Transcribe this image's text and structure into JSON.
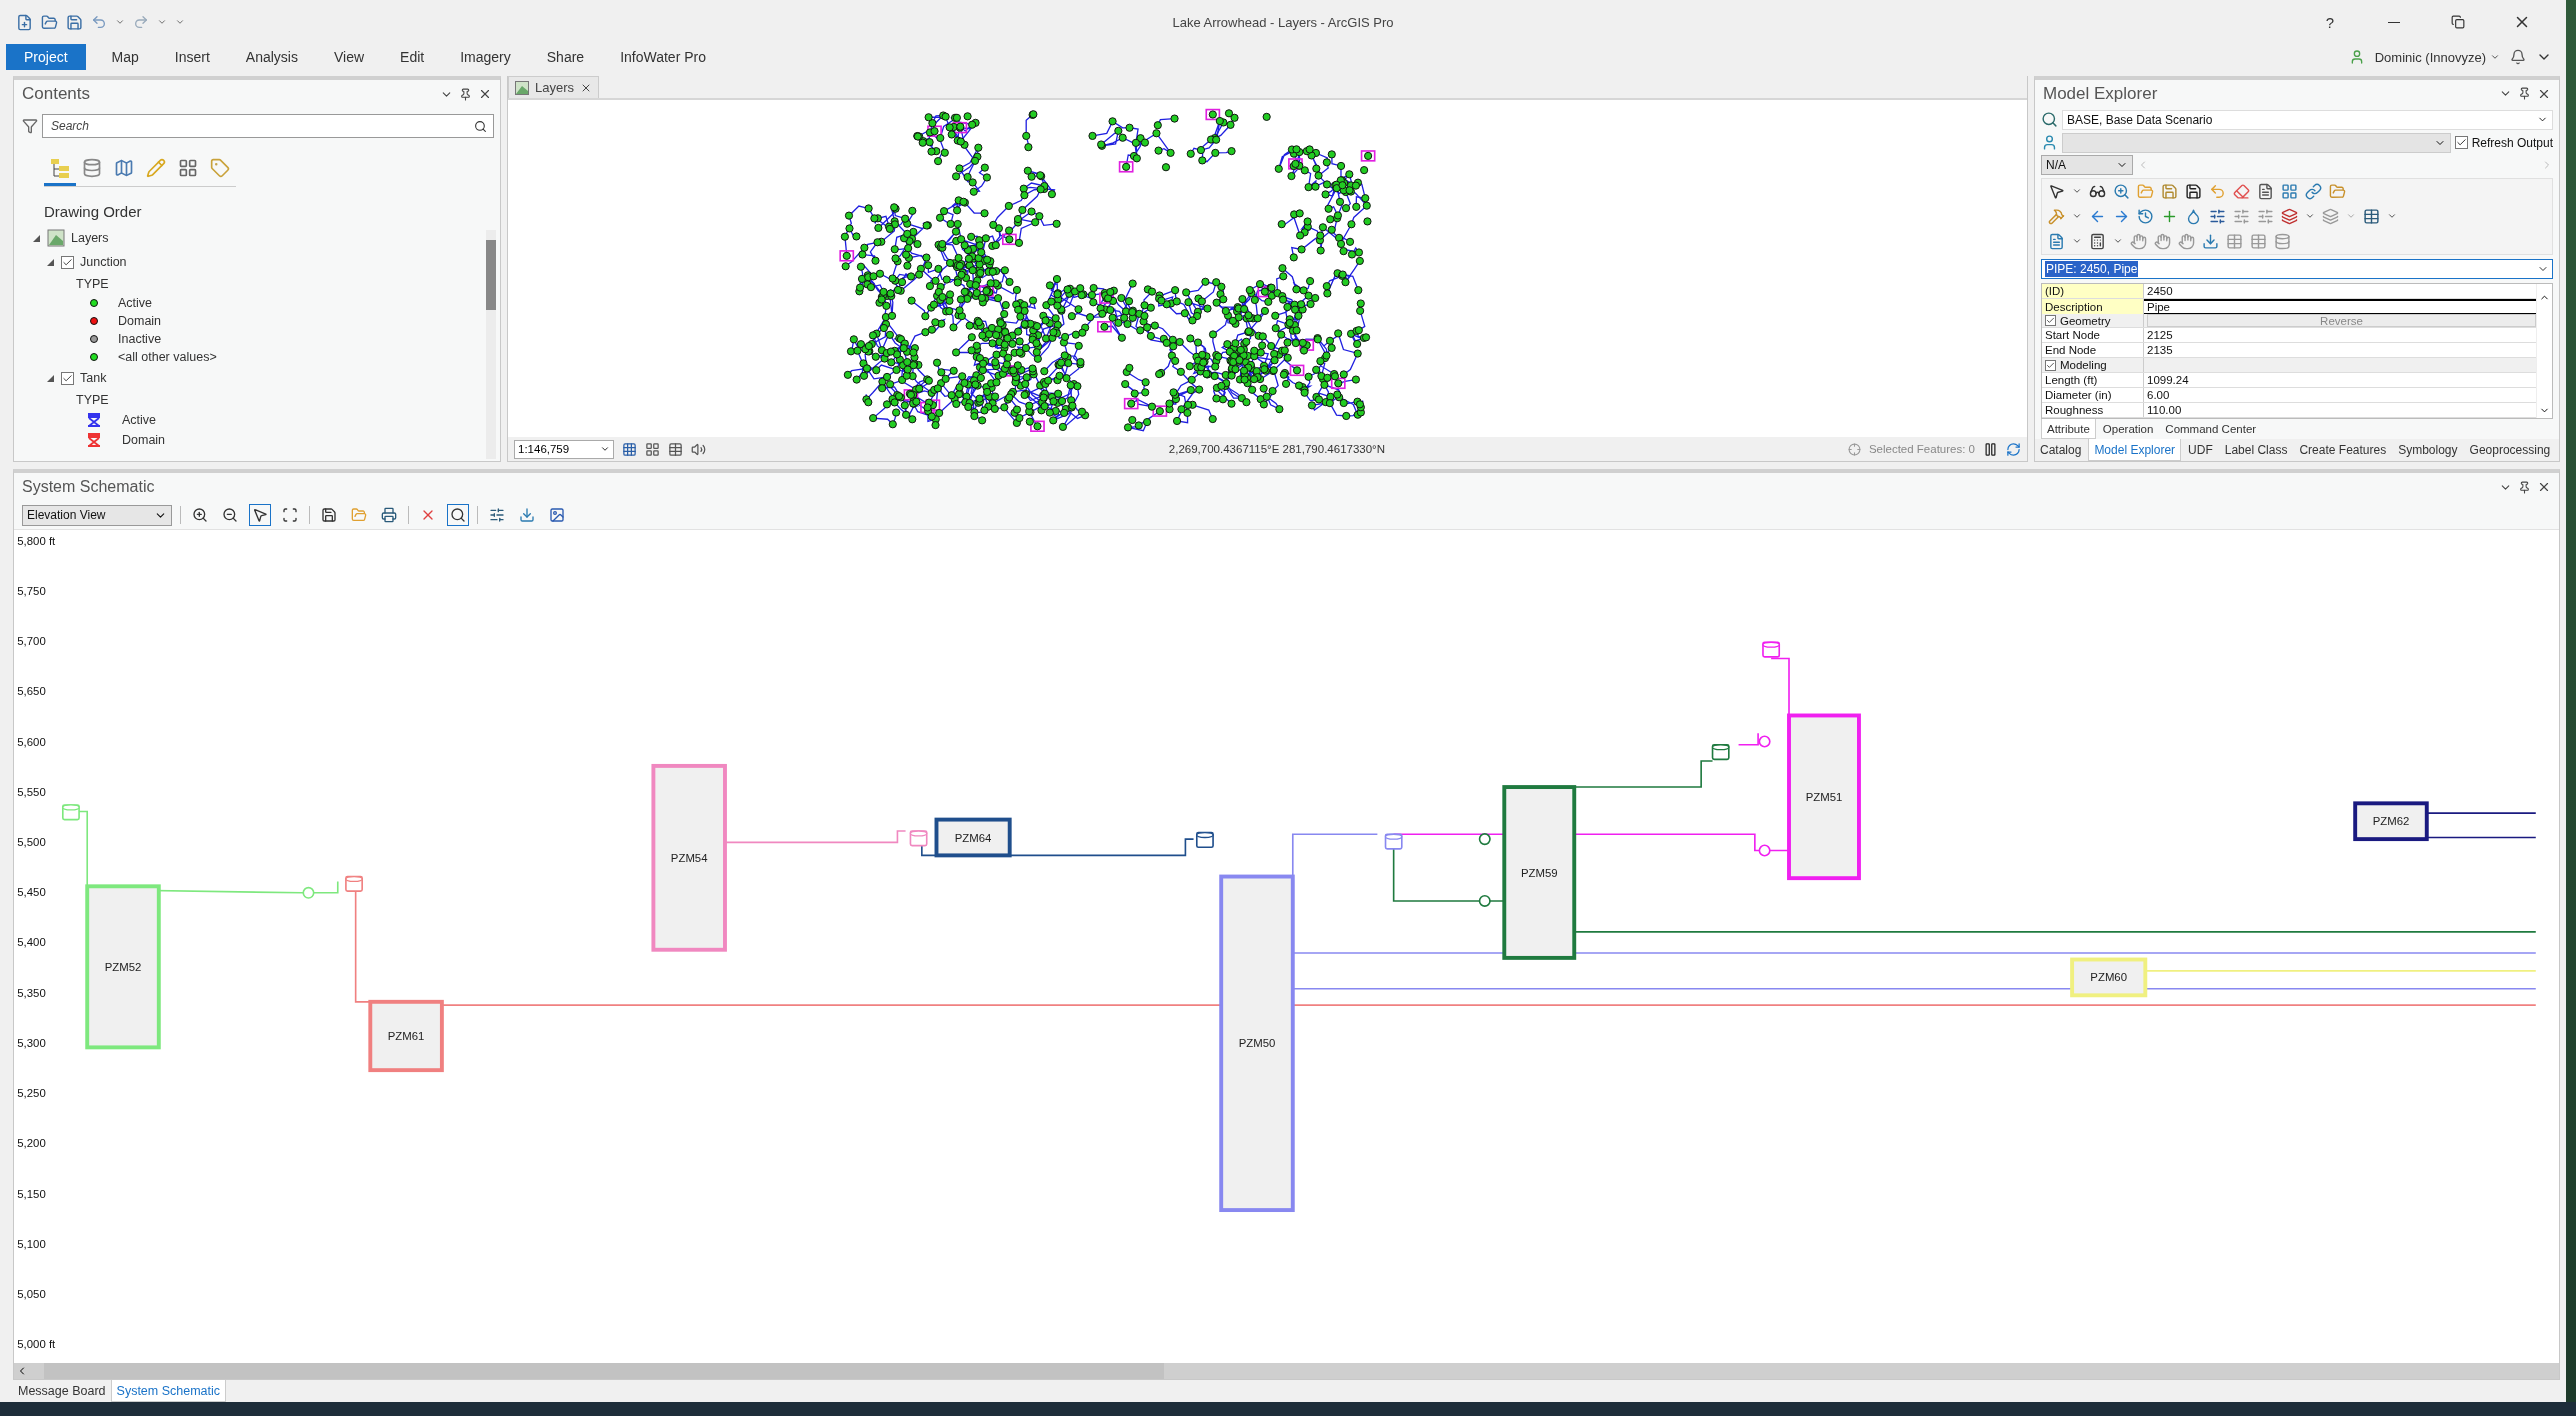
{
  "window": {
    "title": "Lake Arrowhead - Layers - ArcGIS Pro",
    "help": "?"
  },
  "ribbon": {
    "tabs": [
      {
        "label": "Project",
        "selected": true
      },
      {
        "label": "Map",
        "selected": false
      },
      {
        "label": "Insert",
        "selected": false
      },
      {
        "label": "Analysis",
        "selected": false
      },
      {
        "label": "View",
        "selected": false
      },
      {
        "label": "Edit",
        "selected": false
      },
      {
        "label": "Imagery",
        "selected": false
      },
      {
        "label": "Share",
        "selected": false
      },
      {
        "label": "InfoWater Pro",
        "selected": false
      }
    ],
    "user": "Dominic (Innovyze)"
  },
  "contents": {
    "title": "Contents",
    "search": {
      "placeholder": "Search"
    },
    "view_tabs": [
      {
        "selected": true
      },
      {
        "selected": false
      },
      {
        "selected": false
      },
      {
        "selected": false
      },
      {
        "selected": false
      },
      {
        "selected": false
      }
    ],
    "heading": "Drawing Order",
    "tree": [
      {
        "kind": "group",
        "label": "Layers",
        "expanded": true,
        "children": [
          {
            "kind": "layer",
            "label": "Junction",
            "checked": true,
            "expanded": true,
            "children": [
              {
                "kind": "heading",
                "label": "TYPE"
              },
              {
                "kind": "dot",
                "label": "Active",
                "color": "#22dd22"
              },
              {
                "kind": "dot",
                "label": "Domain",
                "color": "#ee1111"
              },
              {
                "kind": "dot",
                "label": "Inactive",
                "color": "#9a9a9a"
              },
              {
                "kind": "dot",
                "label": "<all other values>",
                "color": "#22dd22"
              }
            ]
          },
          {
            "kind": "layer",
            "label": "Tank",
            "checked": true,
            "expanded": true,
            "children": [
              {
                "kind": "heading",
                "label": "TYPE"
              },
              {
                "kind": "tank",
                "label": "Active",
                "color": "#3333ee"
              },
              {
                "kind": "tank",
                "label": "Domain",
                "color": "#ee3333"
              }
            ]
          }
        ]
      }
    ]
  },
  "map": {
    "tab": "Layers",
    "scale": "1:146,759",
    "coordinates": "2,269,700.4367115°E 281,790.4617330°N",
    "selected_features": "Selected Features: 0"
  },
  "model_explorer": {
    "title": "Model Explorer",
    "scenario": "BASE, Base Data Scenario",
    "refresh_output": {
      "label": "Refresh Output",
      "checked": true
    },
    "filter": "N/A",
    "selection": "PIPE: 2450, Pipe",
    "properties": [
      {
        "kind": "field",
        "name": "(ID)",
        "value": "2450",
        "highlight": true,
        "editing": false
      },
      {
        "kind": "field",
        "name": "Description",
        "value": "Pipe",
        "highlight": true,
        "editing": true
      },
      {
        "kind": "section",
        "name": "Geometry",
        "checked": true,
        "action": "Reverse"
      },
      {
        "kind": "field",
        "name": "Start Node",
        "value": "2125",
        "highlight": false,
        "editing": false
      },
      {
        "kind": "field",
        "name": "End Node",
        "value": "2135",
        "highlight": false,
        "editing": false
      },
      {
        "kind": "section",
        "name": "Modeling",
        "checked": true
      },
      {
        "kind": "field",
        "name": "Length (ft)",
        "value": "1099.24",
        "highlight": false,
        "editing": false
      },
      {
        "kind": "field",
        "name": "Diameter (in)",
        "value": "6.00",
        "highlight": false,
        "editing": false
      },
      {
        "kind": "field",
        "name": "Roughness",
        "value": "110.00",
        "highlight": false,
        "editing": false
      }
    ],
    "tabs": [
      {
        "label": "Attribute",
        "selected": true
      },
      {
        "label": "Operation",
        "selected": false
      },
      {
        "label": "Command Center",
        "selected": false
      }
    ],
    "dock_tabs": [
      {
        "label": "Catalog",
        "selected": false
      },
      {
        "label": "Model Explorer",
        "selected": true
      },
      {
        "label": "UDF",
        "selected": false
      },
      {
        "label": "Label Class",
        "selected": false
      },
      {
        "label": "Create Features",
        "selected": false
      },
      {
        "label": "Symbology",
        "selected": false
      },
      {
        "label": "Geoprocessing",
        "selected": false
      }
    ]
  },
  "schematic": {
    "title": "System Schematic",
    "view": "Elevation View",
    "tools": [
      {
        "selected": false
      },
      {
        "selected": false
      },
      {
        "selected": true
      },
      {
        "selected": false
      },
      {
        "selected": false
      },
      {
        "selected": false
      },
      {
        "selected": false
      },
      {
        "selected": false
      },
      {
        "selected": true
      },
      {
        "selected": false
      },
      {
        "selected": false
      },
      {
        "selected": false
      }
    ],
    "yticks": [
      "5,800 ft",
      "5,750",
      "5,700",
      "5,650",
      "5,600",
      "5,550",
      "5,500",
      "5,450",
      "5,400",
      "5,350",
      "5,300",
      "5,250",
      "5,200",
      "5,150",
      "5,100",
      "5,050",
      "5,000 ft"
    ],
    "zones": [
      {
        "label": "PZM52",
        "color": "#7ee87e"
      },
      {
        "label": "PZM61",
        "color": "#f08080"
      },
      {
        "label": "PZM54",
        "color": "#f088c0"
      },
      {
        "label": "PZM64",
        "color": "#1f4e8c"
      },
      {
        "label": "PZM50",
        "color": "#8888f0"
      },
      {
        "label": "PZM59",
        "color": "#1f7a3f"
      },
      {
        "label": "PZM51",
        "color": "#f020f0"
      },
      {
        "label": "PZM60",
        "color": "#f0f080"
      },
      {
        "label": "PZM62",
        "color": "#1a1a80"
      }
    ]
  },
  "bottom_tabs": [
    {
      "label": "Message Board",
      "selected": false
    },
    {
      "label": "System Schematic",
      "selected": true
    }
  ]
}
